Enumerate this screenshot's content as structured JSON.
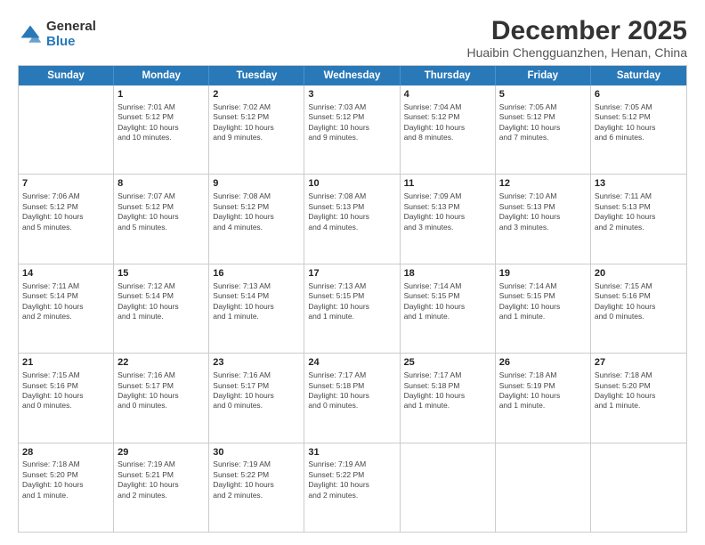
{
  "logo": {
    "general": "General",
    "blue": "Blue"
  },
  "title": "December 2025",
  "subtitle": "Huaibin Chengguanzhen, Henan, China",
  "header_days": [
    "Sunday",
    "Monday",
    "Tuesday",
    "Wednesday",
    "Thursday",
    "Friday",
    "Saturday"
  ],
  "weeks": [
    [
      {
        "day": "",
        "info": ""
      },
      {
        "day": "1",
        "info": "Sunrise: 7:01 AM\nSunset: 5:12 PM\nDaylight: 10 hours\nand 10 minutes."
      },
      {
        "day": "2",
        "info": "Sunrise: 7:02 AM\nSunset: 5:12 PM\nDaylight: 10 hours\nand 9 minutes."
      },
      {
        "day": "3",
        "info": "Sunrise: 7:03 AM\nSunset: 5:12 PM\nDaylight: 10 hours\nand 9 minutes."
      },
      {
        "day": "4",
        "info": "Sunrise: 7:04 AM\nSunset: 5:12 PM\nDaylight: 10 hours\nand 8 minutes."
      },
      {
        "day": "5",
        "info": "Sunrise: 7:05 AM\nSunset: 5:12 PM\nDaylight: 10 hours\nand 7 minutes."
      },
      {
        "day": "6",
        "info": "Sunrise: 7:05 AM\nSunset: 5:12 PM\nDaylight: 10 hours\nand 6 minutes."
      }
    ],
    [
      {
        "day": "7",
        "info": "Sunrise: 7:06 AM\nSunset: 5:12 PM\nDaylight: 10 hours\nand 5 minutes."
      },
      {
        "day": "8",
        "info": "Sunrise: 7:07 AM\nSunset: 5:12 PM\nDaylight: 10 hours\nand 5 minutes."
      },
      {
        "day": "9",
        "info": "Sunrise: 7:08 AM\nSunset: 5:12 PM\nDaylight: 10 hours\nand 4 minutes."
      },
      {
        "day": "10",
        "info": "Sunrise: 7:08 AM\nSunset: 5:13 PM\nDaylight: 10 hours\nand 4 minutes."
      },
      {
        "day": "11",
        "info": "Sunrise: 7:09 AM\nSunset: 5:13 PM\nDaylight: 10 hours\nand 3 minutes."
      },
      {
        "day": "12",
        "info": "Sunrise: 7:10 AM\nSunset: 5:13 PM\nDaylight: 10 hours\nand 3 minutes."
      },
      {
        "day": "13",
        "info": "Sunrise: 7:11 AM\nSunset: 5:13 PM\nDaylight: 10 hours\nand 2 minutes."
      }
    ],
    [
      {
        "day": "14",
        "info": "Sunrise: 7:11 AM\nSunset: 5:14 PM\nDaylight: 10 hours\nand 2 minutes."
      },
      {
        "day": "15",
        "info": "Sunrise: 7:12 AM\nSunset: 5:14 PM\nDaylight: 10 hours\nand 1 minute."
      },
      {
        "day": "16",
        "info": "Sunrise: 7:13 AM\nSunset: 5:14 PM\nDaylight: 10 hours\nand 1 minute."
      },
      {
        "day": "17",
        "info": "Sunrise: 7:13 AM\nSunset: 5:15 PM\nDaylight: 10 hours\nand 1 minute."
      },
      {
        "day": "18",
        "info": "Sunrise: 7:14 AM\nSunset: 5:15 PM\nDaylight: 10 hours\nand 1 minute."
      },
      {
        "day": "19",
        "info": "Sunrise: 7:14 AM\nSunset: 5:15 PM\nDaylight: 10 hours\nand 1 minute."
      },
      {
        "day": "20",
        "info": "Sunrise: 7:15 AM\nSunset: 5:16 PM\nDaylight: 10 hours\nand 0 minutes."
      }
    ],
    [
      {
        "day": "21",
        "info": "Sunrise: 7:15 AM\nSunset: 5:16 PM\nDaylight: 10 hours\nand 0 minutes."
      },
      {
        "day": "22",
        "info": "Sunrise: 7:16 AM\nSunset: 5:17 PM\nDaylight: 10 hours\nand 0 minutes."
      },
      {
        "day": "23",
        "info": "Sunrise: 7:16 AM\nSunset: 5:17 PM\nDaylight: 10 hours\nand 0 minutes."
      },
      {
        "day": "24",
        "info": "Sunrise: 7:17 AM\nSunset: 5:18 PM\nDaylight: 10 hours\nand 0 minutes."
      },
      {
        "day": "25",
        "info": "Sunrise: 7:17 AM\nSunset: 5:18 PM\nDaylight: 10 hours\nand 1 minute."
      },
      {
        "day": "26",
        "info": "Sunrise: 7:18 AM\nSunset: 5:19 PM\nDaylight: 10 hours\nand 1 minute."
      },
      {
        "day": "27",
        "info": "Sunrise: 7:18 AM\nSunset: 5:20 PM\nDaylight: 10 hours\nand 1 minute."
      }
    ],
    [
      {
        "day": "28",
        "info": "Sunrise: 7:18 AM\nSunset: 5:20 PM\nDaylight: 10 hours\nand 1 minute."
      },
      {
        "day": "29",
        "info": "Sunrise: 7:19 AM\nSunset: 5:21 PM\nDaylight: 10 hours\nand 2 minutes."
      },
      {
        "day": "30",
        "info": "Sunrise: 7:19 AM\nSunset: 5:22 PM\nDaylight: 10 hours\nand 2 minutes."
      },
      {
        "day": "31",
        "info": "Sunrise: 7:19 AM\nSunset: 5:22 PM\nDaylight: 10 hours\nand 2 minutes."
      },
      {
        "day": "",
        "info": ""
      },
      {
        "day": "",
        "info": ""
      },
      {
        "day": "",
        "info": ""
      }
    ]
  ]
}
